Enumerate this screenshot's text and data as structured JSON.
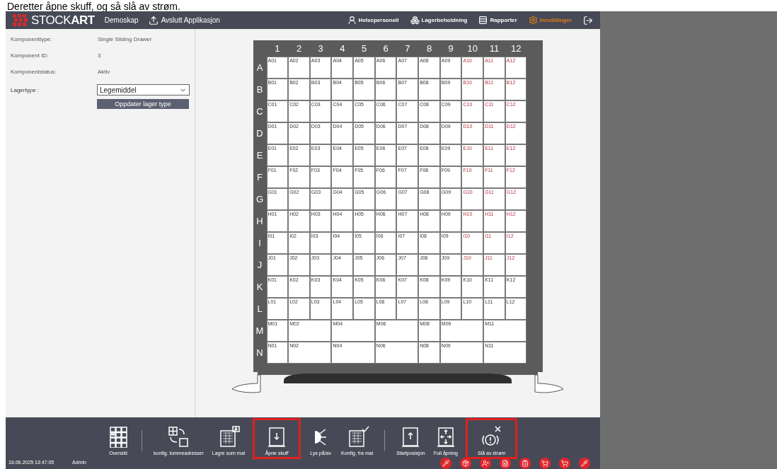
{
  "caption": "Deretter åpne skuff, og så slå av strøm.",
  "header": {
    "brand": {
      "first": "STOCK",
      "second": "ART"
    },
    "links": [
      {
        "label": "Demoskap",
        "kind": "text"
      },
      {
        "label": "Avslutt Applikasjon",
        "kind": "exit"
      }
    ],
    "tabs": [
      {
        "label": "Helsepersonell",
        "kind": "staff",
        "selected": false
      },
      {
        "label": "Lagerbeholdning",
        "kind": "inventory",
        "selected": false
      },
      {
        "label": "Rapporter",
        "kind": "reports",
        "selected": false
      },
      {
        "label": "Innstillinger",
        "kind": "settings",
        "selected": true
      }
    ]
  },
  "details": [
    {
      "label": "Komponenttype:",
      "value": "Single Sliding Drawer"
    },
    {
      "label": "Komponent ID:",
      "value": "3"
    },
    {
      "label": "Komponentstatus:",
      "value": "Aktiv"
    }
  ],
  "storage_type": {
    "label": "Lagertype :",
    "value": "Legemiddel",
    "button": "Oppdater lager type"
  },
  "drawer": {
    "columns": [
      "1",
      "2",
      "3",
      "4",
      "5",
      "6",
      "7",
      "8",
      "9",
      "10",
      "11",
      "12"
    ],
    "rows": [
      {
        "label": "A",
        "cells": [
          {
            "text": "A01",
            "alert": false
          },
          {
            "text": "A02",
            "alert": false
          },
          {
            "text": "A03",
            "alert": false
          },
          {
            "text": "A04",
            "alert": false
          },
          {
            "text": "A05",
            "alert": false
          },
          {
            "text": "A06",
            "alert": false
          },
          {
            "text": "A07",
            "alert": false
          },
          {
            "text": "A08",
            "alert": false
          },
          {
            "text": "A09",
            "alert": false
          },
          {
            "text": "A10",
            "alert": true
          },
          {
            "text": "A11",
            "alert": true
          },
          {
            "text": "A12",
            "alert": true
          }
        ]
      },
      {
        "label": "B",
        "cells": [
          {
            "text": "B01",
            "alert": false
          },
          {
            "text": "B02",
            "alert": false
          },
          {
            "text": "B03",
            "alert": false
          },
          {
            "text": "B04",
            "alert": false
          },
          {
            "text": "B05",
            "alert": false
          },
          {
            "text": "B06",
            "alert": false
          },
          {
            "text": "B07",
            "alert": false
          },
          {
            "text": "B08",
            "alert": false
          },
          {
            "text": "B09",
            "alert": false
          },
          {
            "text": "B10",
            "alert": true
          },
          {
            "text": "B11",
            "alert": true
          },
          {
            "text": "B12",
            "alert": true
          }
        ]
      },
      {
        "label": "C",
        "cells": [
          {
            "text": "C01",
            "alert": false
          },
          {
            "text": "C02",
            "alert": false
          },
          {
            "text": "C03",
            "alert": false
          },
          {
            "text": "C04",
            "alert": false
          },
          {
            "text": "C05",
            "alert": false
          },
          {
            "text": "C06",
            "alert": false
          },
          {
            "text": "C07",
            "alert": false
          },
          {
            "text": "C08",
            "alert": false
          },
          {
            "text": "C09",
            "alert": false
          },
          {
            "text": "C10",
            "alert": true
          },
          {
            "text": "C11",
            "alert": true
          },
          {
            "text": "C12",
            "alert": true
          }
        ]
      },
      {
        "label": "D",
        "cells": [
          {
            "text": "D01",
            "alert": false
          },
          {
            "text": "D02",
            "alert": false
          },
          {
            "text": "D03",
            "alert": false
          },
          {
            "text": "D04",
            "alert": false
          },
          {
            "text": "D05",
            "alert": false
          },
          {
            "text": "D06",
            "alert": false
          },
          {
            "text": "D07",
            "alert": false
          },
          {
            "text": "D08",
            "alert": false
          },
          {
            "text": "D09",
            "alert": false
          },
          {
            "text": "D10",
            "alert": true
          },
          {
            "text": "D11",
            "alert": true
          },
          {
            "text": "D12",
            "alert": true
          }
        ]
      },
      {
        "label": "E",
        "cells": [
          {
            "text": "E01",
            "alert": false
          },
          {
            "text": "E02",
            "alert": false
          },
          {
            "text": "E03",
            "alert": false
          },
          {
            "text": "E04",
            "alert": false
          },
          {
            "text": "E05",
            "alert": false
          },
          {
            "text": "E06",
            "alert": false
          },
          {
            "text": "E07",
            "alert": false
          },
          {
            "text": "E08",
            "alert": false
          },
          {
            "text": "E09",
            "alert": false
          },
          {
            "text": "E10",
            "alert": true
          },
          {
            "text": "E11",
            "alert": true
          },
          {
            "text": "E12",
            "alert": true
          }
        ]
      },
      {
        "label": "F",
        "cells": [
          {
            "text": "F01",
            "alert": false
          },
          {
            "text": "F02",
            "alert": false
          },
          {
            "text": "F03",
            "alert": false
          },
          {
            "text": "F04",
            "alert": false
          },
          {
            "text": "F05",
            "alert": false
          },
          {
            "text": "F06",
            "alert": false
          },
          {
            "text": "F07",
            "alert": false
          },
          {
            "text": "F08",
            "alert": false
          },
          {
            "text": "F09",
            "alert": false
          },
          {
            "text": "F10",
            "alert": true
          },
          {
            "text": "F11",
            "alert": true
          },
          {
            "text": "F12",
            "alert": true
          }
        ]
      },
      {
        "label": "G",
        "cells": [
          {
            "text": "G01",
            "alert": false
          },
          {
            "text": "G02",
            "alert": false
          },
          {
            "text": "G03",
            "alert": false
          },
          {
            "text": "G04",
            "alert": false
          },
          {
            "text": "G05",
            "alert": false
          },
          {
            "text": "G06",
            "alert": false
          },
          {
            "text": "G07",
            "alert": false
          },
          {
            "text": "G08",
            "alert": false
          },
          {
            "text": "G09",
            "alert": false
          },
          {
            "text": "G10",
            "alert": true
          },
          {
            "text": "G11",
            "alert": true
          },
          {
            "text": "G12",
            "alert": true
          }
        ]
      },
      {
        "label": "H",
        "cells": [
          {
            "text": "H01",
            "alert": false
          },
          {
            "text": "H02",
            "alert": false
          },
          {
            "text": "H03",
            "alert": false
          },
          {
            "text": "H04",
            "alert": false
          },
          {
            "text": "H05",
            "alert": false
          },
          {
            "text": "H06",
            "alert": false
          },
          {
            "text": "H07",
            "alert": false
          },
          {
            "text": "H08",
            "alert": false
          },
          {
            "text": "H09",
            "alert": false
          },
          {
            "text": "H10",
            "alert": true
          },
          {
            "text": "H11",
            "alert": true
          },
          {
            "text": "H12",
            "alert": true
          }
        ]
      },
      {
        "label": "I",
        "cells": [
          {
            "text": "I01",
            "alert": false
          },
          {
            "text": "I02",
            "alert": false
          },
          {
            "text": "I03",
            "alert": false
          },
          {
            "text": "I04",
            "alert": false
          },
          {
            "text": "I05",
            "alert": false
          },
          {
            "text": "I06",
            "alert": false
          },
          {
            "text": "I07",
            "alert": false
          },
          {
            "text": "I08",
            "alert": false
          },
          {
            "text": "I09",
            "alert": false
          },
          {
            "text": "I10",
            "alert": true
          },
          {
            "text": "I11",
            "alert": true
          },
          {
            "text": "I12",
            "alert": true
          }
        ]
      },
      {
        "label": "J",
        "cells": [
          {
            "text": "J01",
            "alert": false
          },
          {
            "text": "J02",
            "alert": false
          },
          {
            "text": "J03",
            "alert": false
          },
          {
            "text": "J04",
            "alert": false
          },
          {
            "text": "J05",
            "alert": false
          },
          {
            "text": "J06",
            "alert": false
          },
          {
            "text": "J07",
            "alert": false
          },
          {
            "text": "J08",
            "alert": false
          },
          {
            "text": "J09",
            "alert": false
          },
          {
            "text": "J10",
            "alert": true
          },
          {
            "text": "J11",
            "alert": true
          },
          {
            "text": "J12",
            "alert": true
          }
        ]
      },
      {
        "label": "K",
        "cells": [
          {
            "text": "K01",
            "alert": false
          },
          {
            "text": "K02",
            "alert": false
          },
          {
            "text": "K03",
            "alert": false
          },
          {
            "text": "K04",
            "alert": false
          },
          {
            "text": "K05",
            "alert": false
          },
          {
            "text": "K06",
            "alert": false
          },
          {
            "text": "K07",
            "alert": false
          },
          {
            "text": "K08",
            "alert": false
          },
          {
            "text": "K09",
            "alert": false
          },
          {
            "text": "K10",
            "alert": false
          },
          {
            "text": "K11",
            "alert": false
          },
          {
            "text": "K12",
            "alert": false
          }
        ]
      },
      {
        "label": "L",
        "cells": [
          {
            "text": "L01",
            "alert": false
          },
          {
            "text": "L02",
            "alert": false
          },
          {
            "text": "L03",
            "alert": false
          },
          {
            "text": "L04",
            "alert": false
          },
          {
            "text": "L05",
            "alert": false
          },
          {
            "text": "L06",
            "alert": false
          },
          {
            "text": "L07",
            "alert": false
          },
          {
            "text": "L08",
            "alert": false
          },
          {
            "text": "L09",
            "alert": false
          },
          {
            "text": "L10",
            "alert": false
          },
          {
            "text": "L11",
            "alert": false
          },
          {
            "text": "L12",
            "alert": false
          }
        ]
      },
      {
        "label": "M",
        "cells": [
          {
            "text": "M01",
            "kind": "single"
          },
          {
            "text": "M02",
            "kind": "double"
          },
          {
            "text": "M04",
            "kind": "double"
          },
          {
            "text": "M06",
            "kind": "double"
          },
          {
            "text": "M08",
            "kind": "single"
          },
          {
            "text": "M09",
            "kind": "double"
          },
          {
            "text": "M11",
            "kind": "double"
          }
        ]
      },
      {
        "label": "N",
        "cells": [
          {
            "text": "N01",
            "kind": "single"
          },
          {
            "text": "N02",
            "kind": "double"
          },
          {
            "text": "N04",
            "kind": "double"
          },
          {
            "text": "N06",
            "kind": "double"
          },
          {
            "text": "N08",
            "kind": "single"
          },
          {
            "text": "N09",
            "kind": "double"
          },
          {
            "text": "N11",
            "kind": "double"
          }
        ]
      }
    ]
  },
  "toolbar": {
    "groups": [
      [
        {
          "label": "Oversikt",
          "kind": "overview",
          "highlighted": false
        }
      ],
      [
        {
          "label": "konfig. lommeadresser",
          "kind": "config-addresses",
          "highlighted": false
        },
        {
          "label": "Lagre som mal",
          "kind": "save-template",
          "highlighted": false
        },
        {
          "label": "Åpne skuff",
          "kind": "open-drawer",
          "highlighted": true
        },
        {
          "label": "Lys på/av",
          "kind": "light",
          "highlighted": false
        },
        {
          "label": "Konfig. fra mal",
          "kind": "config-template",
          "highlighted": false
        }
      ],
      [
        {
          "label": "Startposisjon",
          "kind": "start-position",
          "highlighted": false
        },
        {
          "label": "Full åpning",
          "kind": "full-opening",
          "highlighted": false
        },
        {
          "label": "Slå av strøm",
          "kind": "power-off",
          "highlighted": true
        }
      ]
    ]
  },
  "status": {
    "timestamp": "16.06.2025 13:47:05",
    "user": "Admin"
  }
}
